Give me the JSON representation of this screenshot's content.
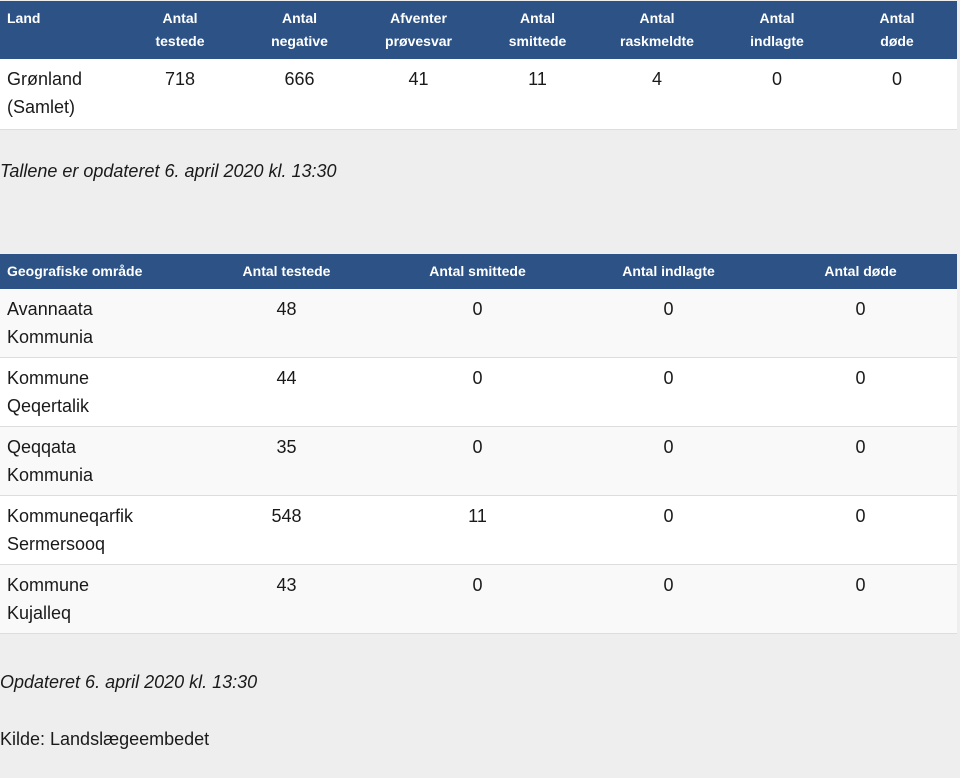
{
  "summary_table": {
    "headers": [
      "Land",
      "Antal\ntestede",
      "Antal\nnegative",
      "Afventer\nprøvesvar",
      "Antal\nsmittede",
      "Antal\nraskmeldte",
      "Antal\nindlagte",
      "Antal\ndøde"
    ],
    "rows": [
      [
        "Grønland\n(Samlet)",
        "718",
        "666",
        "41",
        "11",
        "4",
        "0",
        "0"
      ]
    ]
  },
  "summary_note": "Tallene er opdateret 6. april 2020 kl. 13:30",
  "region_table": {
    "headers": [
      "Geografiske område",
      "Antal testede",
      "Antal smittede",
      "Antal indlagte",
      "Antal døde"
    ],
    "rows": [
      [
        "Avannaata\nKommunia",
        "48",
        "0",
        "0",
        "0"
      ],
      [
        "Kommune\nQeqertalik",
        "44",
        "0",
        "0",
        "0"
      ],
      [
        "Qeqqata\nKommunia",
        "35",
        "0",
        "0",
        "0"
      ],
      [
        "Kommuneqarfik\nSermersooq",
        "548",
        "11",
        "0",
        "0"
      ],
      [
        "Kommune\nKujalleq",
        "43",
        "0",
        "0",
        "0"
      ]
    ]
  },
  "region_note": "Opdateret 6. april 2020 kl. 13:30",
  "source": "Kilde: Landslægeembedet",
  "colors": {
    "header_bg": "#2d5386",
    "page_bg": "#eeeeee"
  }
}
